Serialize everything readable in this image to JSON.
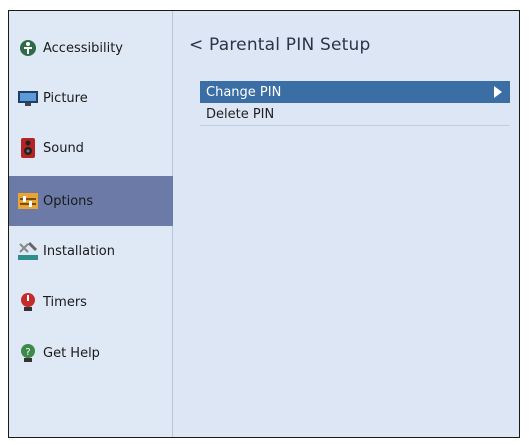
{
  "sidebar": {
    "items": [
      {
        "label": "Accessibility",
        "icon": "accessibility-icon"
      },
      {
        "label": "Picture",
        "icon": "picture-icon"
      },
      {
        "label": "Sound",
        "icon": "sound-icon"
      },
      {
        "label": "Options",
        "icon": "options-icon",
        "active": true
      },
      {
        "label": "Installation",
        "icon": "installation-icon"
      },
      {
        "label": "Timers",
        "icon": "timers-icon"
      },
      {
        "label": "Get Help",
        "icon": "get-help-icon"
      }
    ]
  },
  "main": {
    "title": "< Parental PIN Setup",
    "menu": [
      {
        "label": "Change PIN",
        "selected": true
      },
      {
        "label": "Delete PIN"
      }
    ]
  },
  "colors": {
    "panel": "#dde6f4",
    "sidebar_active": "#6b7aa6",
    "selected_row": "#3a6ea5"
  }
}
